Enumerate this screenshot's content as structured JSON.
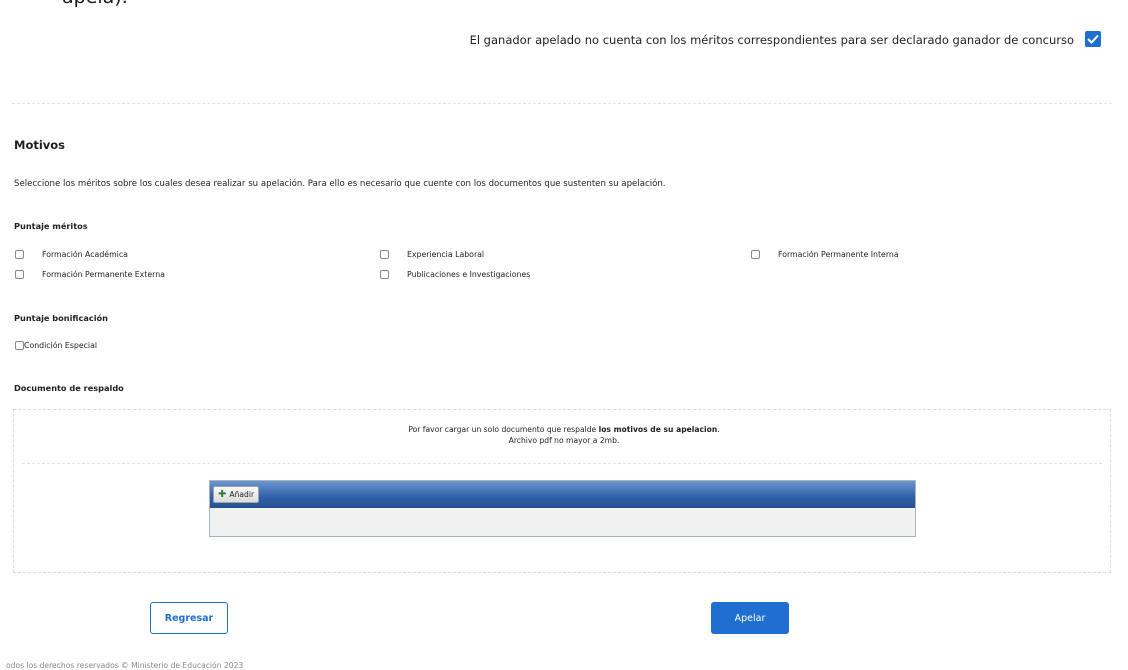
{
  "top_text_cut": "apela).",
  "ganador": {
    "label": "El ganador apelado no cuenta con los méritos correspondientes para ser declarado ganador de concurso",
    "checked": true,
    "check_color": "#1e6fd0"
  },
  "motivos": {
    "title": "Motivos",
    "description": "Seleccione los méritos sobre los cuales desea realizar su apelación. Para ello es necesario que cuente con los documentos que sustenten su apelación.",
    "puntaje_meritos": {
      "title": "Puntaje méritos",
      "items": [
        "Formación Académica",
        "Experiencia Laboral",
        "Formación Permanente Interna",
        "Formación Permanente Externa",
        "Publicaciones e Investigaciones"
      ]
    },
    "puntaje_bonificacion": {
      "title": "Puntaje bonificación",
      "items": [
        "Condición Especial"
      ]
    }
  },
  "documento": {
    "title": "Documento de respaldo",
    "instruction_pre": "Por favor cargar un solo documento que respalde ",
    "instruction_bold": "los motivos de su apelacion",
    "instruction_post": ".",
    "size_note": "Archivo pdf no mayor a 2mb.",
    "add_label": "Añadir"
  },
  "buttons": {
    "regresar": "Regresar",
    "apelar": "Apelar"
  },
  "footer": "odos los derechos reservados © Ministerio de Educación 2023",
  "colors": {
    "primary": "#1e6fd0",
    "uploader_bar": "#2f5fa8"
  }
}
